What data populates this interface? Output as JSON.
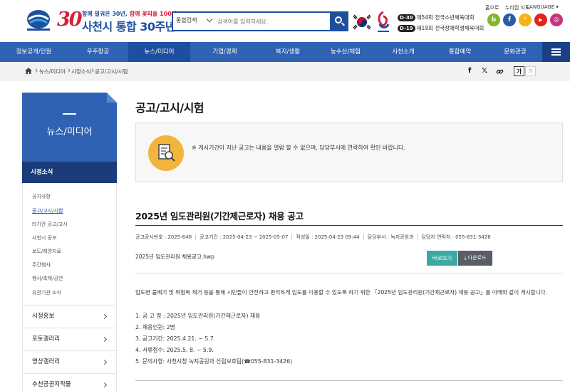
{
  "header": {
    "logo_slogan_part1": "함께 일궈온 30년, ",
    "logo_slogan_part2": "함께 꽃피울 100년!",
    "logo_number": "30",
    "logo_main": "사천시 통합 30주년",
    "search": {
      "category": "통합검색",
      "placeholder": "검색어를 입력하세요."
    },
    "dday": [
      {
        "tag": "D-30",
        "text": "제54회 전국소년체육대회"
      },
      {
        "tag": "D-19",
        "text": "제19회 전국장애학생체육대회"
      }
    ],
    "util_links": [
      "홈으로",
      "누리집 지도",
      "LANGUAGE"
    ],
    "sns": [
      {
        "icon": "blog-icon",
        "glyph": "b",
        "color": "#80b82a"
      },
      {
        "icon": "facebook-icon",
        "glyph": "f",
        "color": "#2d5aa8"
      },
      {
        "icon": "kakaostory-icon",
        "glyph": "❛",
        "color": "#f6b21b"
      },
      {
        "icon": "youtube-icon",
        "glyph": "▶",
        "color": "#e62117"
      },
      {
        "icon": "instagram-icon",
        "glyph": "◎",
        "color": "#c8327d"
      }
    ]
  },
  "gnb": {
    "items": [
      "정보공개/민원",
      "우주항공",
      "뉴스/미디어",
      "기업/경제",
      "복지/생활",
      "농수산/체험",
      "사천소개",
      "통합예약",
      "문화관광"
    ],
    "active_index": 2
  },
  "breadcrumb": [
    "뉴스/미디어",
    "시정소식",
    "공고/고시/시험"
  ],
  "font_size_buttons": [
    "가",
    "가"
  ],
  "sidebar": {
    "title": "뉴스/미디어",
    "section": "시정소식",
    "links": [
      "공지사항",
      "공고/고시/시험",
      "타기관 공고/고시",
      "사천시 공보",
      "보도/해명자료",
      "주간행사",
      "행사/축제/공연",
      "유관기관 소식"
    ],
    "active_link": 1,
    "categories": [
      "시정홍보",
      "포토갤러리",
      "영상갤러리",
      "추천공공저작물"
    ]
  },
  "content": {
    "page_title": "공고/고시/시험",
    "notice": "※ 게시기간이 지난 공고는 내용을 열람 할 수 없으며, 담당부서에 연락하여 확인 바랍니다.",
    "post": {
      "title": "2025년 임도관리원(기간제근로자) 채용 공고",
      "meta": [
        "공고공시번호 : 2025-648",
        "공고기간 : 2025-04-23 ~ 2025-05-07",
        "작성일 : 2025-04-23 09:44",
        "담당부서 : 녹지공원과",
        "담당자 연락처 : 055-831-3426"
      ],
      "file_name": "2025년 임도관리원 채용공고.hwp",
      "view_button": "바로보기",
      "download_button": "다운로드",
      "intro": "임도변 풀베기 및 위험목 제거 등을 통해 시민들이 안전하고 편리하게 임도를 이용할 수 있도록 하기 위한 「2025년 임도관리원(기간제근로자) 채용 공고」를 아래와 같이 게시합니다.",
      "items": [
        "1. 공 고 명 : 2025년 임도관리원(기간제근로자) 채용",
        "2. 채용인원: 2명",
        "3. 공고기간: 2025.4.21. ~ 5.7.",
        "4. 서류접수: 2025.5. 8. ~ 5.9.",
        "5. 문의사항: 사천시청 녹지공원과 산림보호팀(☎055-831-3426)"
      ]
    }
  }
}
